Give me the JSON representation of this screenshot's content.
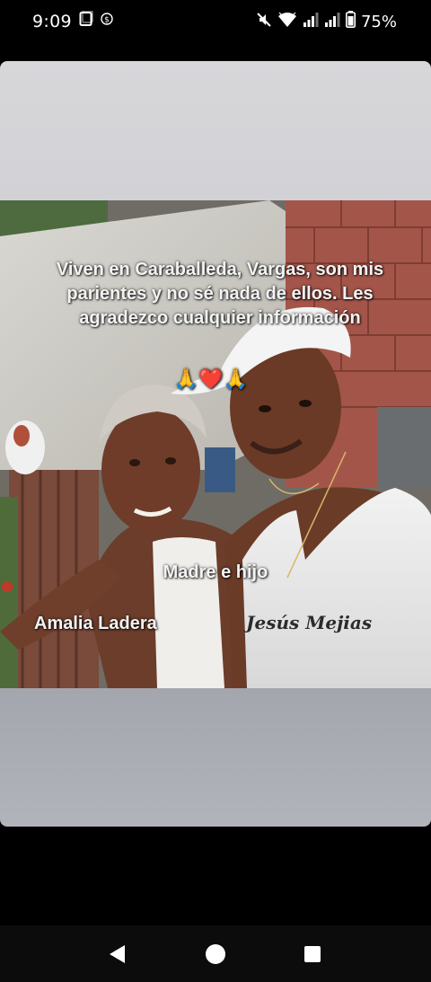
{
  "status_bar": {
    "time": "9:09",
    "battery_percent": "75%",
    "icons": [
      "screenshot-icon",
      "dollar-icon",
      "mute-icon",
      "wifi-icon",
      "signal-icon",
      "signal-icon",
      "battery-icon"
    ]
  },
  "post": {
    "caption_text": "Viven en Caraballeda, Vargas, son mis parientes y no sé nada de ellos. Les agradezco cualquier información",
    "caption_emoji": "🙏❤️🙏",
    "label_relation": "Madre e hijo",
    "label_mother": "Amalia Ladera",
    "label_son": "Jesús Mejias"
  },
  "navigation": {
    "icons": [
      "back-icon",
      "home-icon",
      "recents-icon"
    ]
  },
  "colors": {
    "card_top": "#d2d2d6",
    "card_bottom": "#aaadb3",
    "nav_bar": "#0c0c0c"
  }
}
